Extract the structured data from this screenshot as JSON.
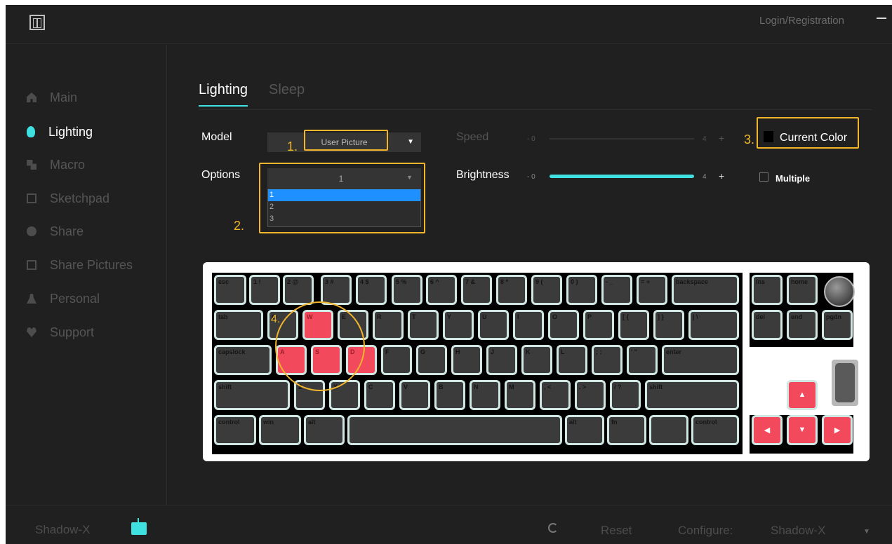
{
  "titlebar": {
    "login": "Login/Registration"
  },
  "sidebar": {
    "items": [
      {
        "label": "Main",
        "icon": "home-icon"
      },
      {
        "label": "Lighting",
        "icon": "bulb-icon"
      },
      {
        "label": "Macro",
        "icon": "macro-icon"
      },
      {
        "label": "Sketchpad",
        "icon": "sketchpad-icon"
      },
      {
        "label": "Share",
        "icon": "share-icon"
      },
      {
        "label": "Share Pictures",
        "icon": "picture-icon"
      },
      {
        "label": "Personal",
        "icon": "person-icon"
      },
      {
        "label": "Support",
        "icon": "heart-icon"
      }
    ]
  },
  "tabs": {
    "lighting": "Lighting",
    "sleep": "Sleep"
  },
  "controls": {
    "model_label": "Model",
    "model_value": "User Picture",
    "options_label": "Options",
    "options_value": "1",
    "options_list": [
      "1",
      "2",
      "3"
    ],
    "speed_label": "Speed",
    "speed_min": "- 0",
    "speed_max": "4",
    "speed_plus": "+",
    "speed_level": 0,
    "brightness_label": "Brightness",
    "brightness_min": "- 0",
    "brightness_max": "4",
    "brightness_plus": "+",
    "brightness_level": 4,
    "current_color_label": "Current Color",
    "current_color": "#000000",
    "multiple_label": "Multiple"
  },
  "annotations": {
    "one": "1.",
    "two": "2.",
    "three": "3.",
    "four": "4."
  },
  "keyboard": {
    "row1": [
      "esc",
      "1 !",
      "2 @",
      "3 #",
      "4 $",
      "5 %",
      "6 ^",
      "7 &",
      "8 *",
      "9 (",
      "0 )",
      "- _",
      "= +",
      "backspace"
    ],
    "row2": [
      "tab",
      "Q",
      "W",
      "E",
      "R",
      "T",
      "Y",
      "U",
      "I",
      "O",
      "P",
      "[ {",
      "] }",
      "| \\"
    ],
    "row3": [
      "capslock",
      "A",
      "S",
      "D",
      "F",
      "G",
      "H",
      "J",
      "K",
      "L",
      "; :",
      "' \"",
      "enter"
    ],
    "row4": [
      "shift",
      "Z",
      "X",
      "C",
      "V",
      "B",
      "N",
      "M",
      ", <",
      ". >",
      "/ ?",
      "shift"
    ],
    "row5": [
      "control",
      "win",
      "alt",
      "",
      "alt",
      "fn",
      "",
      "control"
    ],
    "nav": [
      "ins",
      "home",
      "del",
      "end",
      "pgdn"
    ]
  },
  "colors": {
    "accent": "#3fe0e0",
    "annotation": "#f2b52c",
    "highlight_key": "#f24a5c"
  },
  "footer": {
    "device": "Shadow-X",
    "reset": "Reset",
    "configure_label": "Configure:",
    "configure_value": "Shadow-X"
  }
}
